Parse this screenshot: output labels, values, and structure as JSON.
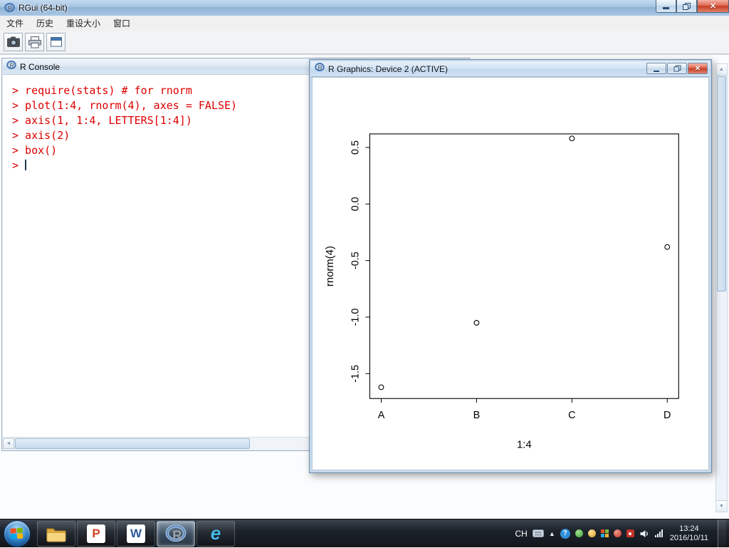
{
  "titlebar": {
    "title": "RGui (64-bit)"
  },
  "menubar": {
    "items": [
      "文件",
      "历史",
      "重设大小",
      "窗口"
    ]
  },
  "toolbar": {
    "buttons": [
      {
        "label": "copy"
      },
      {
        "label": "print"
      },
      {
        "label": "windows"
      }
    ]
  },
  "mdi": {
    "console": {
      "title": "R Console",
      "lines": [
        "> require(stats) # for rnorm",
        "> plot(1:4, rnorm(4), axes = FALSE)",
        "> axis(1, 1:4, LETTERS[1:4])",
        "> axis(2)",
        "> box()",
        "> "
      ]
    },
    "graphics": {
      "title": "R Graphics: Device 2 (ACTIVE)"
    }
  },
  "chart_data": {
    "type": "scatter",
    "x": [
      1,
      2,
      3,
      4
    ],
    "y": [
      -1.62,
      -1.05,
      0.58,
      -0.38
    ],
    "x_tick_labels": [
      "A",
      "B",
      "C",
      "D"
    ],
    "y_ticks": [
      0.5,
      0.0,
      -0.5,
      -1.0,
      -1.5
    ],
    "xlabel": "1:4",
    "ylabel": "rnorm(4)",
    "xlim": [
      0.88,
      4.12
    ],
    "ylim": [
      -1.72,
      0.62
    ],
    "marker": "open-circle",
    "grid": false,
    "box": true
  },
  "taskbar": {
    "apps": [
      {
        "name": "explorer"
      },
      {
        "name": "powerpoint",
        "letter": "P"
      },
      {
        "name": "word",
        "letter": "W"
      },
      {
        "name": "r",
        "active": true
      },
      {
        "name": "ie",
        "letter": "e"
      }
    ],
    "tray": {
      "language": "CH",
      "time": "13:24",
      "date": "2016/10/11"
    }
  },
  "icons": {
    "close": "✕",
    "help": "?",
    "show_hidden": "▲"
  },
  "colors": {
    "console_input": "#dd0000",
    "close_button": "#c63d24",
    "titlebar_top": "#c3daf0",
    "titlebar_bottom": "#8fb4da"
  }
}
